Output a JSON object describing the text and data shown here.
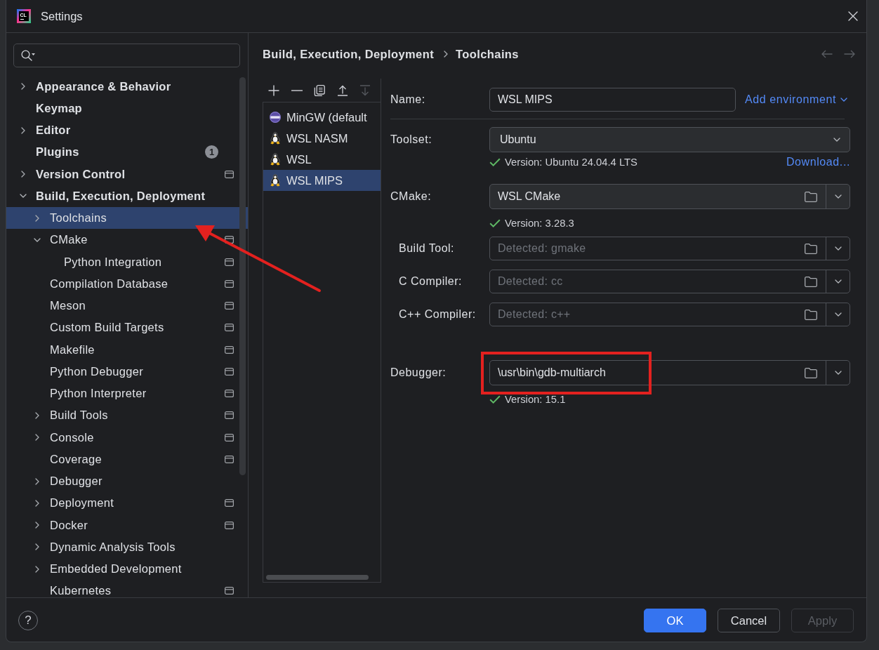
{
  "window": {
    "logo_text": "CL",
    "title": "Settings"
  },
  "sidebar": {
    "items": [
      {
        "label": "Appearance & Behavior",
        "expanded": false,
        "project_scope": false,
        "selected": false
      },
      {
        "label": "Keymap",
        "project_scope": false,
        "selected": false
      },
      {
        "label": "Editor",
        "expanded": false,
        "project_scope": false,
        "selected": false
      },
      {
        "label": "Plugins",
        "project_scope": false,
        "selected": false,
        "badge": "1"
      },
      {
        "label": "Version Control",
        "expanded": false,
        "project_scope": true,
        "selected": false
      },
      {
        "label": "Build, Execution, Deployment",
        "expanded": true,
        "project_scope": false,
        "selected": false,
        "children": [
          {
            "label": "Toolchains",
            "expanded": false,
            "project_scope": false,
            "selected": true
          },
          {
            "label": "CMake",
            "expanded": true,
            "project_scope": true,
            "selected": false,
            "children": [
              {
                "label": "Python Integration",
                "project_scope": true,
                "selected": false
              }
            ]
          },
          {
            "label": "Compilation Database",
            "project_scope": true,
            "selected": false
          },
          {
            "label": "Meson",
            "project_scope": true,
            "selected": false
          },
          {
            "label": "Custom Build Targets",
            "project_scope": true,
            "selected": false
          },
          {
            "label": "Makefile",
            "project_scope": true,
            "selected": false
          },
          {
            "label": "Python Debugger",
            "project_scope": true,
            "selected": false
          },
          {
            "label": "Python Interpreter",
            "project_scope": true,
            "selected": false
          },
          {
            "label": "Build Tools",
            "expanded": false,
            "project_scope": true,
            "selected": false
          },
          {
            "label": "Console",
            "expanded": false,
            "project_scope": true,
            "selected": false
          },
          {
            "label": "Coverage",
            "project_scope": true,
            "selected": false
          },
          {
            "label": "Debugger",
            "expanded": false,
            "project_scope": false,
            "selected": false
          },
          {
            "label": "Deployment",
            "expanded": false,
            "project_scope": true,
            "selected": false
          },
          {
            "label": "Docker",
            "expanded": false,
            "project_scope": true,
            "selected": false
          },
          {
            "label": "Dynamic Analysis Tools",
            "expanded": false,
            "project_scope": false,
            "selected": false
          },
          {
            "label": "Embedded Development",
            "expanded": false,
            "project_scope": false,
            "selected": false
          },
          {
            "label": "Kubernetes",
            "project_scope": true,
            "selected": false
          }
        ]
      }
    ]
  },
  "breadcrumb": [
    "Build, Execution, Deployment",
    "Toolchains"
  ],
  "navigation": [
    {
      "kind": "back",
      "disabled": true
    },
    {
      "kind": "forward",
      "disabled": true
    }
  ],
  "toolchains": {
    "toolbar": [
      {
        "kind": "add",
        "disabled": false
      },
      {
        "kind": "remove",
        "disabled": false
      },
      {
        "kind": "copy",
        "disabled": false
      },
      {
        "kind": "move_up",
        "disabled": false
      },
      {
        "kind": "move_down",
        "disabled": true
      }
    ],
    "items": [
      {
        "name": "MinGW (default",
        "kind": "gnu",
        "selected": false
      },
      {
        "name": "WSL NASM",
        "kind": "wsl",
        "selected": false
      },
      {
        "name": "WSL",
        "kind": "wsl",
        "selected": false
      },
      {
        "name": "WSL MIPS",
        "kind": "wsl",
        "selected": true
      }
    ]
  },
  "form": {
    "rows": [
      {
        "kind": "text",
        "label": "Name:",
        "value": "WSL MIPS",
        "link": "Add environment"
      },
      {
        "kind": "dropdown",
        "label": "Toolset:",
        "value": "Ubuntu",
        "status": {
          "valid": true,
          "text": "Version: Ubuntu 24.04.4 LTS"
        },
        "link": "Download..."
      },
      {
        "kind": "path",
        "label": "CMake:",
        "value": "WSL CMake",
        "editable": false,
        "status": {
          "valid": true,
          "text": "Version: 3.28.3"
        },
        "children": [
          {
            "label": "Build Tool:",
            "placeholder": "Detected: gmake",
            "editable": true
          },
          {
            "label": "C Compiler:",
            "placeholder": "Detected: cc",
            "editable": true
          },
          {
            "label": "C++ Compiler:",
            "placeholder": "Detected: c++",
            "editable": true
          }
        ]
      },
      {
        "kind": "path",
        "label": "Debugger:",
        "value": "\\usr\\bin\\gdb-multiarch",
        "editable": true,
        "status": {
          "valid": true,
          "text": "Version: 15.1"
        }
      }
    ]
  },
  "footer": {
    "help": "?",
    "buttons": [
      {
        "label": "OK",
        "kind": "primary",
        "disabled": false
      },
      {
        "label": "Cancel",
        "kind": "secondary",
        "disabled": false
      },
      {
        "label": "Apply",
        "kind": "secondary",
        "disabled": true
      }
    ]
  },
  "annotations": {
    "arrow": true,
    "highlight_box": true
  }
}
